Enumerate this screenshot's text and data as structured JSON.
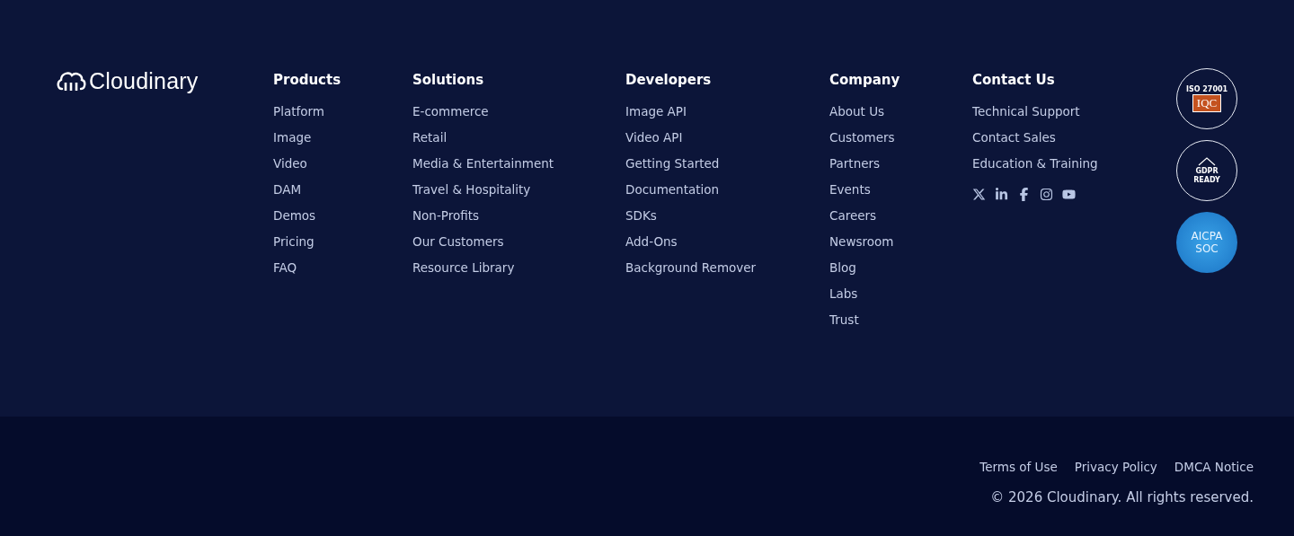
{
  "logo": {
    "name": "Cloudinary"
  },
  "columns": [
    {
      "heading": "Products",
      "links": [
        "Platform",
        "Image",
        "Video",
        "DAM",
        "Demos",
        "Pricing",
        "FAQ"
      ]
    },
    {
      "heading": "Solutions",
      "links": [
        "E-commerce",
        "Retail",
        "Media & Entertainment",
        "Travel & Hospitality",
        "Non-Profits",
        "Our Customers",
        "Resource Library"
      ]
    },
    {
      "heading": "Developers",
      "links": [
        "Image API",
        "Video API",
        "Getting Started",
        "Documentation",
        "SDKs",
        "Add-Ons",
        "Background Remover"
      ]
    },
    {
      "heading": "Company",
      "links": [
        "About Us",
        "Customers",
        "Partners",
        "Events",
        "Careers",
        "Newsroom",
        "Blog",
        "Labs",
        "Trust"
      ]
    }
  ],
  "contact": {
    "heading": "Contact Us",
    "links": [
      "Technical Support",
      "Contact Sales",
      "Education & Training"
    ],
    "social": [
      {
        "kind": "x"
      },
      {
        "kind": "linkedin"
      },
      {
        "kind": "facebook"
      },
      {
        "kind": "instagram"
      },
      {
        "kind": "youtube"
      }
    ]
  },
  "badges": [
    {
      "kind": "iso",
      "top": "ISO 27001",
      "label": "IQC"
    },
    {
      "kind": "gdpr",
      "label": "GDPR",
      "bottom": "READY"
    },
    {
      "kind": "soc",
      "top": "AICPA",
      "label": "SOC"
    }
  ],
  "legal_links": [
    "Terms of Use",
    "Privacy Policy",
    "DMCA Notice"
  ],
  "copyright": "© 2026 Cloudinary. All rights reserved."
}
